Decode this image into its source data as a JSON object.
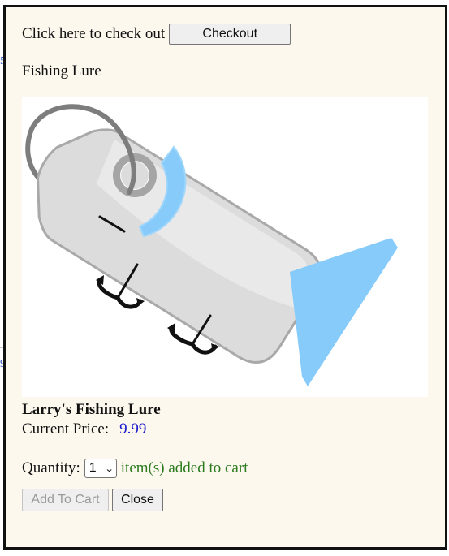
{
  "checkout": {
    "prompt": "Click here to check out",
    "button_label": "Checkout"
  },
  "product": {
    "name": "Fishing Lure",
    "image_icon": "fishing-lure-tag-image",
    "title": "Larry's Fishing Lure",
    "price_label": "Current Price:",
    "price_value": "9.99"
  },
  "cart": {
    "quantity_label": "Quantity:",
    "quantity_value": "1",
    "status_message": "item(s) added to cart",
    "add_button_label": "Add To Cart",
    "add_button_disabled": true,
    "close_button_label": "Close"
  },
  "background": {
    "glyphs": [
      "5",
      "9"
    ]
  },
  "colors": {
    "dialog_background": "#fdf8ee",
    "price": "#1a1acc",
    "status": "#2a7a1e",
    "lure_blue": "#87cbfa",
    "lure_gray": "#d9d9d9"
  }
}
